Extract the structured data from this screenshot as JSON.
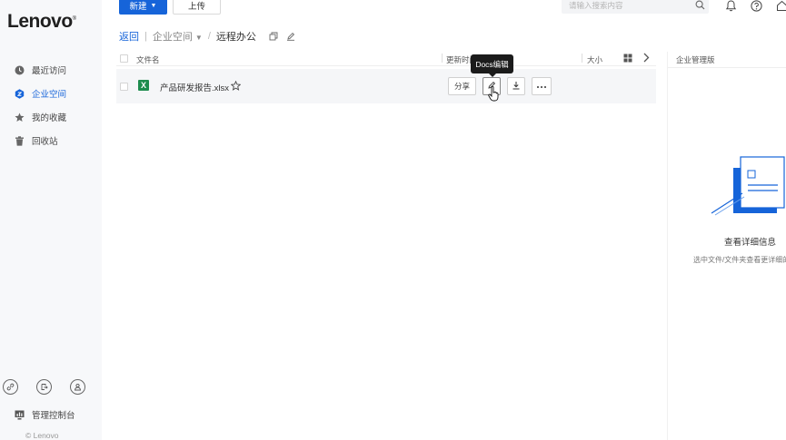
{
  "brand": {
    "logo": "Lenovo",
    "copyright": "© Lenovo",
    "accent": "#1664d9"
  },
  "toolbar": {
    "new_label": "新建",
    "upload_label": "上传"
  },
  "search": {
    "placeholder": "请输入搜索内容"
  },
  "sidebar": {
    "items": [
      {
        "label": "最近访问",
        "icon": "clock-icon"
      },
      {
        "label": "企业空间",
        "icon": "enterprise-space-icon",
        "active": true
      },
      {
        "label": "我的收藏",
        "icon": "star-icon"
      },
      {
        "label": "回收站",
        "icon": "trash-icon"
      }
    ],
    "admin_label": "管理控制台"
  },
  "breadcrumb": {
    "back": "返回",
    "space": "企业空间",
    "current": "远程办公"
  },
  "table": {
    "columns": {
      "name": "文件名",
      "updated": "更新时间",
      "size": "大小"
    },
    "rows": [
      {
        "name": "产品研发报告.xlsx",
        "type": "xlsx"
      }
    ],
    "actions": {
      "share": "分享"
    },
    "tooltip": "Docs编辑"
  },
  "details_panel": {
    "title": "企业管理版",
    "empty_title": "查看详细信息",
    "empty_hint": "选中文件/文件夹查看更详细的"
  }
}
